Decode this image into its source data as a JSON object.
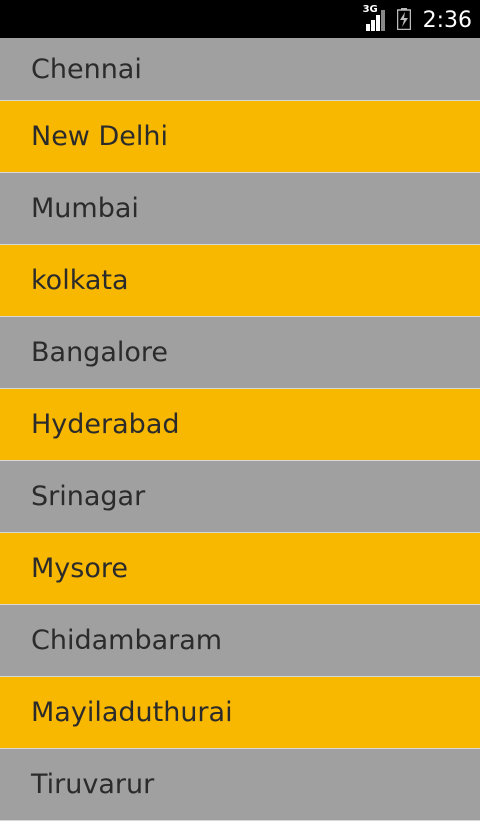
{
  "status_bar": {
    "network": "3G",
    "time": "2:36",
    "icons": [
      "signal-icon",
      "battery-charging-icon"
    ]
  },
  "colors": {
    "row_gray": "#a0a0a0",
    "row_yellow": "#f9b800",
    "text": "#2b2b2b",
    "status_bar": "#000000"
  },
  "cities": [
    {
      "label": "Chennai"
    },
    {
      "label": "New Delhi"
    },
    {
      "label": "Mumbai"
    },
    {
      "label": "kolkata"
    },
    {
      "label": "Bangalore"
    },
    {
      "label": "Hyderabad"
    },
    {
      "label": "Srinagar"
    },
    {
      "label": "Mysore"
    },
    {
      "label": "Chidambaram"
    },
    {
      "label": "Mayiladuthurai"
    },
    {
      "label": "Tiruvarur"
    }
  ]
}
